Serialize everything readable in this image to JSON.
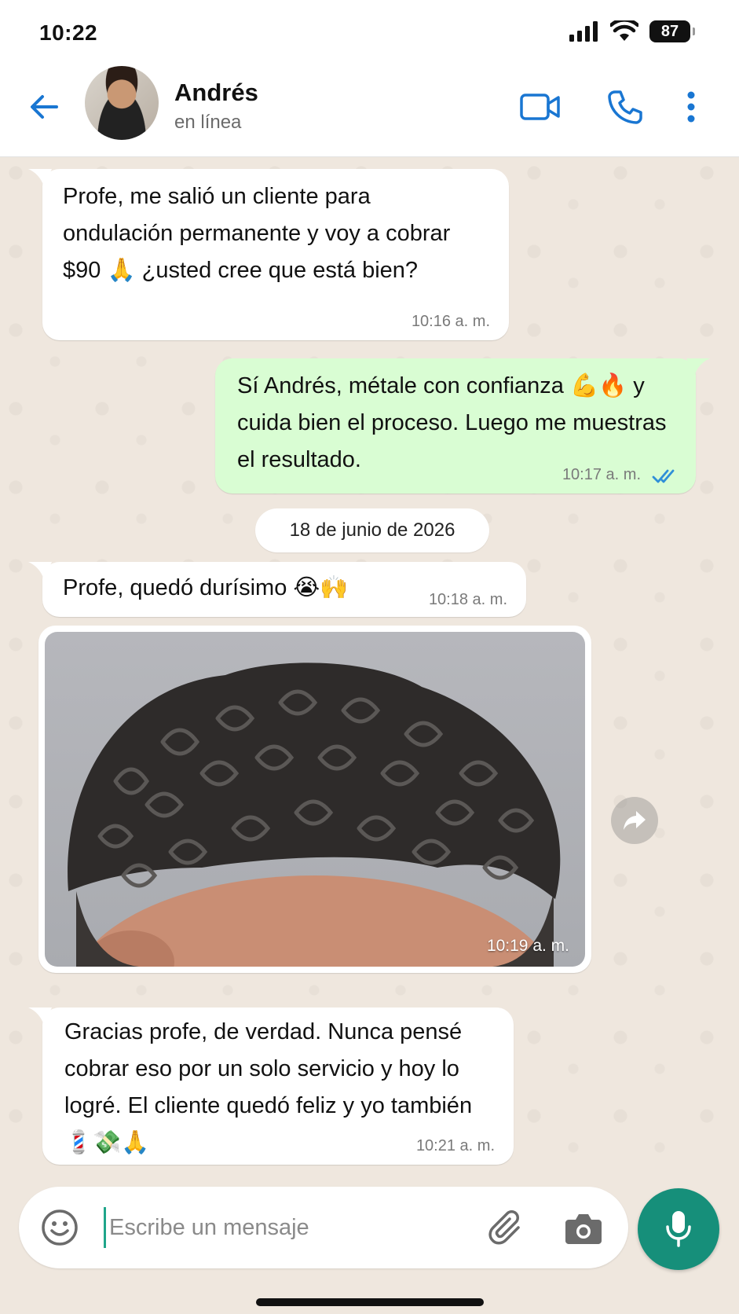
{
  "status_bar": {
    "time": "10:22",
    "battery": "87"
  },
  "header": {
    "contact_name": "Andrés",
    "contact_status": "en línea"
  },
  "messages": [
    {
      "direction": "in",
      "text": "Profe, me salió un cliente para ondulación permanente y voy a cobrar $90 🙏 ¿usted cree que está bien?",
      "time": "10:16 a. m."
    },
    {
      "direction": "out",
      "text": "Sí Andrés, métale con confianza 💪🔥 y cuida bien el proceso. Luego me muestras el resultado.",
      "time": "10:17 a. m."
    },
    {
      "direction": "in",
      "text": "Profe, quedó durísimo 😭🙌",
      "time": "10:18 a. m."
    },
    {
      "direction": "in",
      "type": "image",
      "time": "10:19 a. m."
    },
    {
      "direction": "in",
      "text": "Gracias profe, de verdad. Nunca pensé cobrar eso por un solo servicio y hoy lo logré. El cliente quedó feliz y yo también 💈💸🙏",
      "time": "10:21 a. m."
    }
  ],
  "date_separator": "18 de junio de 2026",
  "composer": {
    "placeholder": "Escribe un mensaje"
  },
  "colors": {
    "accent": "#1976d2",
    "outgoing_bubble": "#d9fdd3",
    "mic_button": "#168f7a",
    "read_ticks": "#2f8fd8"
  }
}
